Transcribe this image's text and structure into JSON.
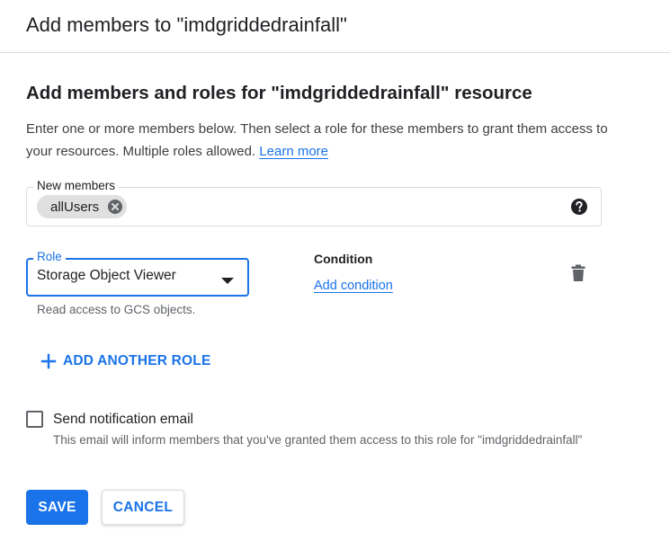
{
  "header": {
    "title": "Add members to \"imdgriddedrainfall\""
  },
  "section": {
    "title": "Add members and roles for \"imdgriddedrainfall\" resource",
    "description": "Enter one or more members below. Then select a role for these members to grant them access to your resources. Multiple roles allowed.",
    "learn_more": "Learn more"
  },
  "members": {
    "label": "New members",
    "chips": [
      "allUsers"
    ],
    "help_icon": "help-circle-icon"
  },
  "role": {
    "label": "Role",
    "value": "Storage Object Viewer",
    "helper": "Read access to GCS objects.",
    "condition_label": "Condition",
    "add_condition": "Add condition",
    "delete_icon": "trash-icon"
  },
  "add_role": {
    "label": "ADD ANOTHER ROLE"
  },
  "notification": {
    "checked": false,
    "label": "Send notification email",
    "helper": "This email will inform members that you've granted them access to this role for \"imdgriddedrainfall\""
  },
  "actions": {
    "save": "SAVE",
    "cancel": "CANCEL"
  },
  "colors": {
    "accent": "#1a73e8",
    "text": "#202124",
    "muted": "#5f6368",
    "border": "#dadce0",
    "chip": "#e0e0e0"
  }
}
